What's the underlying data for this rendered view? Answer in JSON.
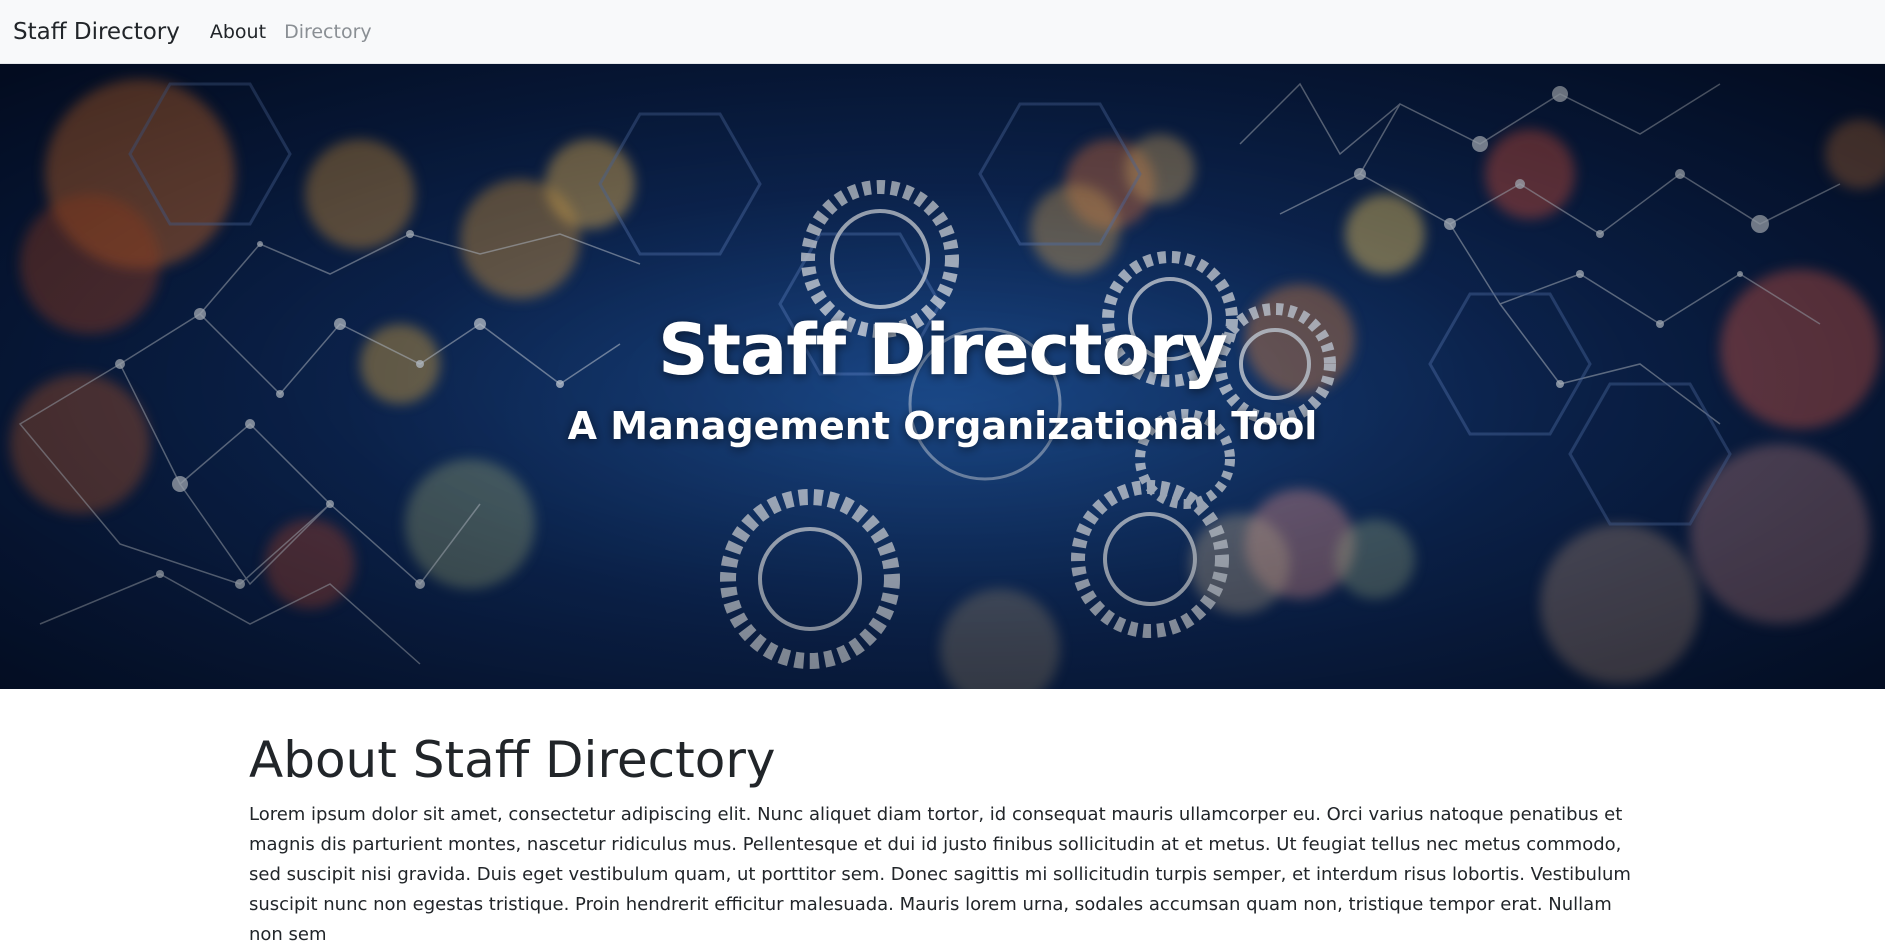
{
  "navbar": {
    "brand": "Staff Directory",
    "links": [
      {
        "label": "About",
        "active": true
      },
      {
        "label": "Directory",
        "active": false
      }
    ]
  },
  "hero": {
    "title": "Staff Directory",
    "subtitle": "A Management Organizational Tool",
    "background_image": "gears-network-bokeh-image",
    "colors": {
      "base": "#0e2a5c",
      "accent_warm": "#e8894a",
      "accent_cool": "#6aa0d8"
    }
  },
  "about": {
    "heading": "About Staff Directory",
    "paragraph": "Lorem ipsum dolor sit amet, consectetur adipiscing elit. Nunc aliquet diam tortor, id consequat mauris ullamcorper eu. Orci varius natoque penatibus et magnis dis parturient montes, nascetur ridiculus mus. Pellentesque et dui id justo finibus sollicitudin at et metus. Ut feugiat tellus nec metus commodo, sed suscipit nisi gravida. Duis eget vestibulum quam, ut porttitor sem. Donec sagittis mi sollicitudin turpis semper, et interdum risus lobortis. Vestibulum suscipit nunc non egestas tristique. Proin hendrerit efficitur malesuada. Mauris lorem urna, sodales accumsan quam non, tristique tempor erat. Nullam non sem"
  }
}
